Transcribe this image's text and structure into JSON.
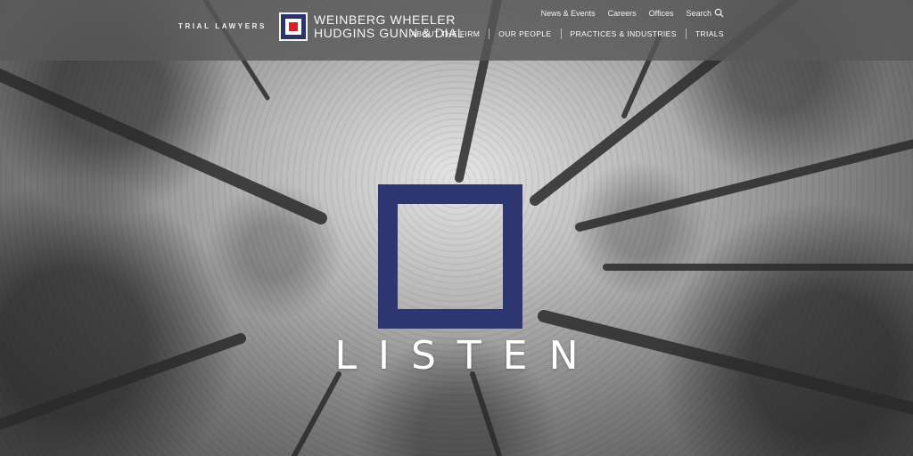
{
  "header": {
    "tagline": "TRIAL LAWYERS",
    "firm_name_line1": "WEINBERG WHEELER",
    "firm_name_line2": "HUDGINS GUNN & DIAL",
    "utility_nav": [
      "News & Events",
      "Careers",
      "Offices",
      "Search"
    ],
    "main_nav": [
      "ABOUT THE FIRM",
      "OUR PEOPLE",
      "PRACTICES & INDUSTRIES",
      "TRIALS"
    ]
  },
  "hero": {
    "word": "LISTEN"
  },
  "colors": {
    "brand_navy": "#2d3670",
    "brand_red": "#d42027",
    "header_bg": "#585858"
  },
  "icons": {
    "search": "search-icon",
    "logo": "logo-mark-icon"
  }
}
